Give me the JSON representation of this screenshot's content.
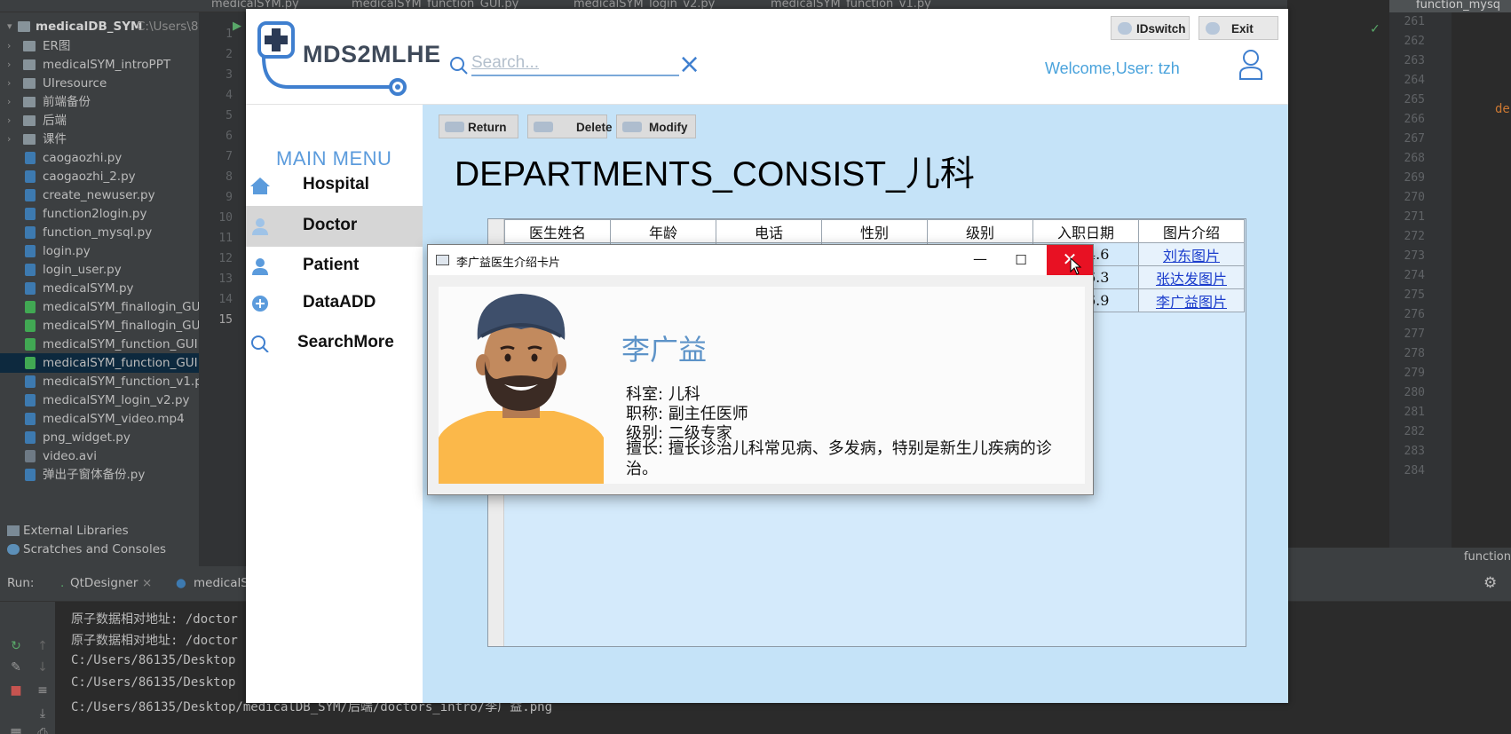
{
  "ide": {
    "tabs": [
      "medicalSYM.py",
      "medicalSYM_function_GUI.py",
      "medicalSYM_login_v2.py",
      "medicalSYM_function_v1.py",
      "function_mysq"
    ],
    "project": {
      "root": "medicalDB_SYM",
      "root_path": "C:\\Users\\86",
      "items": [
        {
          "label": "ER图",
          "type": "folder"
        },
        {
          "label": "medicalSYM_introPPT",
          "type": "folder"
        },
        {
          "label": "UIresource",
          "type": "folder"
        },
        {
          "label": "前端备份",
          "type": "folder"
        },
        {
          "label": "后端",
          "type": "folder"
        },
        {
          "label": "课件",
          "type": "folder"
        },
        {
          "label": "caogaozhi.py",
          "type": "py"
        },
        {
          "label": "caogaozhi_2.py",
          "type": "py"
        },
        {
          "label": "create_newuser.py",
          "type": "py"
        },
        {
          "label": "function2login.py",
          "type": "py"
        },
        {
          "label": "function_mysql.py",
          "type": "py"
        },
        {
          "label": "login.py",
          "type": "py"
        },
        {
          "label": "login_user.py",
          "type": "py"
        },
        {
          "label": "medicalSYM.py",
          "type": "py"
        },
        {
          "label": "medicalSYM_finallogin_GU",
          "type": "qt"
        },
        {
          "label": "medicalSYM_finallogin_GU",
          "type": "qt"
        },
        {
          "label": "medicalSYM_function_GUI.",
          "type": "qt"
        },
        {
          "label": "medicalSYM_function_GUI.",
          "type": "qt",
          "selected": true
        },
        {
          "label": "medicalSYM_function_v1.p",
          "type": "py"
        },
        {
          "label": "medicalSYM_login_v2.py",
          "type": "py"
        },
        {
          "label": "medicalSYM_video.mp4",
          "type": "py"
        },
        {
          "label": "png_widget.py",
          "type": "py"
        },
        {
          "label": "video.avi",
          "type": "mp4"
        },
        {
          "label": "弹出子窗体备份.py",
          "type": "py"
        }
      ],
      "external_libraries": "External Libraries",
      "scratches": "Scratches and Consoles"
    },
    "left_line_numbers": [
      "1",
      "2",
      "3",
      "4",
      "5",
      "6",
      "7",
      "8",
      "9",
      "10",
      "11",
      "12",
      "13",
      "14",
      "15"
    ],
    "right_line_numbers": [
      "261",
      "262",
      "263",
      "264",
      "265",
      "266",
      "267",
      "268",
      "269",
      "270",
      "271",
      "272",
      "273",
      "274",
      "275",
      "276",
      "277",
      "278",
      "279",
      "280",
      "281",
      "282",
      "283",
      "284"
    ],
    "right_code_fragment": "de",
    "right_status": "function",
    "run": {
      "label": "Run:",
      "tab1": "QtDesigner",
      "tab2": "medicalS",
      "console": [
        "原子数据相对地址: /doctor",
        "原子数据相对地址: /doctor",
        "C:/Users/86135/Desktop",
        "C:/Users/86135/Desktop",
        "C:/Users/86135/Desktop/medicalDB_SYM/后端/doctors_intro/李广益.png"
      ]
    }
  },
  "app": {
    "logo_text": "MDS2MLHE",
    "search_placeholder": "Search...",
    "buttons": {
      "idswitch": "IDswitch",
      "exit": "Exit"
    },
    "welcome": "Welcome,User: tzh",
    "menu_title": "MAIN MENU",
    "menu": [
      {
        "label": "Hospital",
        "icon": "home-icon"
      },
      {
        "label": "Doctor",
        "icon": "doctor-icon",
        "active": true
      },
      {
        "label": "Patient",
        "icon": "person-icon"
      },
      {
        "label": "DataADD",
        "icon": "add-icon"
      },
      {
        "label": "SearchMore",
        "icon": "search-icon"
      }
    ],
    "toolbar": {
      "return": "Return",
      "delete": "Delete",
      "modify": "Modify"
    },
    "heading": "DEPARTMENTS_CONSIST_儿科",
    "table": {
      "columns": [
        "医生姓名",
        "年龄",
        "电话",
        "性别",
        "级别",
        "入职日期",
        "图片介绍"
      ],
      "rows": [
        {
          "date": "4.6",
          "link": "刘东图片"
        },
        {
          "date": "6.3",
          "link": "张达发图片"
        },
        {
          "date": "6.9",
          "link": "李广益图片"
        }
      ]
    }
  },
  "dialog": {
    "title": "李广益医生介绍卡片",
    "name": "李广益",
    "department": "科室:  儿科",
    "title_line": "职称:  副主任医师",
    "level": "级别:  二级专家",
    "specialty": "擅长:  擅长诊治儿科常见病、多发病，特别是新生儿疾病的诊治。",
    "colors": {
      "close_bg": "#e81123",
      "name": "#5d93c8"
    }
  },
  "colors": {
    "accent": "#4aa3dc",
    "content_bg": "#c5e3f8",
    "menu_title": "#5b9bdc"
  }
}
